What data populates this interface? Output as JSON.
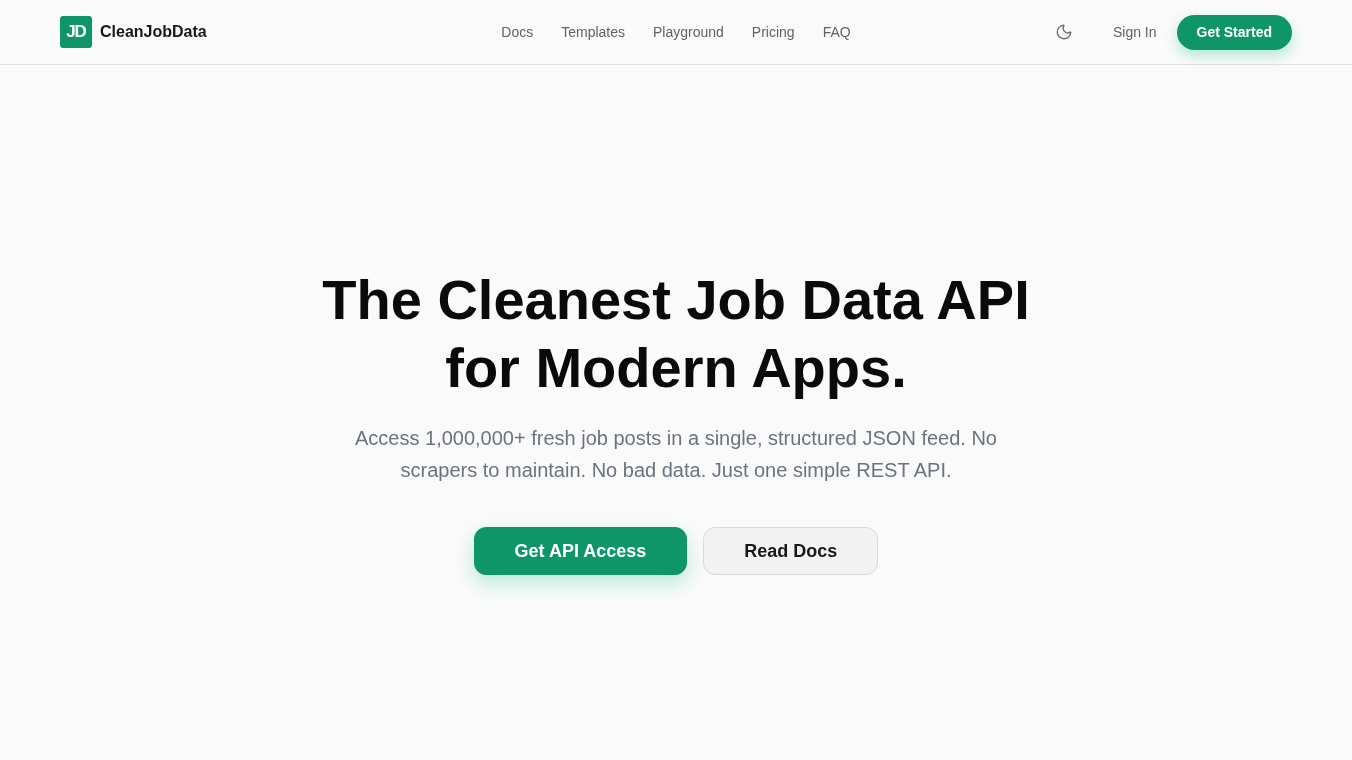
{
  "header": {
    "logo": {
      "mark": "JD",
      "name": "CleanJobData"
    },
    "nav": [
      "Docs",
      "Templates",
      "Playground",
      "Pricing",
      "FAQ"
    ],
    "sign_in": "Sign In",
    "cta": "Get Started"
  },
  "hero": {
    "title": "The Cleanest Job Data API for Modern Apps.",
    "subtitle": "Access 1,000,000+ fresh job posts in a single, structured JSON feed. No scrapers to maintain. No bad data. Just one simple REST API.",
    "buttons": [
      {
        "label": "Get API Access",
        "kind": "primary"
      },
      {
        "label": "Read Docs",
        "kind": "secondary"
      }
    ]
  }
}
